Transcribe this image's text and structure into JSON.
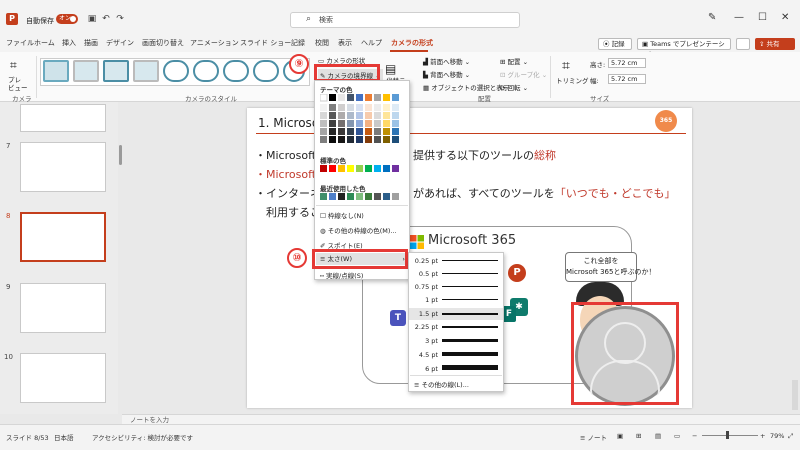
{
  "titlebar": {
    "app_logo": "P",
    "autosave_label": "自動保存",
    "autosave_toggle": "オン",
    "search_placeholder": "検索"
  },
  "tabs": [
    "ファイル",
    "ホーム",
    "挿入",
    "描画",
    "デザイン",
    "画面切り替え",
    "アニメーション",
    "スライド ショー",
    "記録",
    "校閲",
    "表示",
    "ヘルプ",
    "カメラの形式"
  ],
  "active_tab": "カメラの形式",
  "header_buttons": {
    "record": "記録",
    "teams": "Teams でプレゼンテーション",
    "share": "共有"
  },
  "ribbon": {
    "preview_label": "プレ\nビュー",
    "camera_group": "カメラ",
    "styles_group": "カメラのスタイル",
    "camera_shape": "カメラの形状",
    "camera_border": "カメラの境界線",
    "alt_text": "代替テ",
    "bring_forward": "前面へ移動",
    "send_backward": "背面へ移動",
    "selection_pane": "オブジェクトの選択と表示",
    "align": "配置",
    "group": "グループ化",
    "rotate": "回転",
    "arrange_group": "配置",
    "crop": "トリミング",
    "height_label": "高さ:",
    "height_value": "5.72 cm",
    "width_label": "幅:",
    "width_value": "5.72 cm",
    "size_group": "サイズ"
  },
  "callouts": {
    "step9": "⑨",
    "step10": "⑩"
  },
  "slides_panel": {
    "numbers": [
      "7",
      "8",
      "9",
      "10"
    ],
    "selected": "8"
  },
  "slide": {
    "title": "1. Microso",
    "bullet1_a": "・Microsoft 3",
    "bullet1_b": "提供する以下のツールの",
    "bullet1_c": "総称",
    "bullet2": "・Microsoft 3",
    "bullet3_a": "・インターネ",
    "bullet3_b": "があれば、すべてのツールを",
    "bullet3_c": "「いつでも・どこでも」",
    "bullet4": "利用するこ",
    "ms365": "Microsoft 365",
    "speech": "これ全部を\nMicrosoft 365と呼ぶのか！",
    "badge": "カレッジ\n365"
  },
  "menu": {
    "theme_colors": "テーマの色",
    "standard_colors": "標準の色",
    "recent_colors": "最近使用した色",
    "no_outline": "枠線なし(N)",
    "more_colors": "その他の枠線の色(M)...",
    "eyedropper": "スポイト(E)",
    "weight": "太さ(W)",
    "dashes": "実線/点線(S)"
  },
  "weights": {
    "items": [
      "0.25 pt",
      "0.5 pt",
      "0.75 pt",
      "1 pt",
      "1.5 pt",
      "2.25 pt",
      "3 pt",
      "4.5 pt",
      "6 pt"
    ],
    "selected": "1.5 pt",
    "more": "その他の線(L)..."
  },
  "notes": "ノートを入力",
  "status": {
    "slide": "スライド 8/53",
    "language": "日本語",
    "accessibility": "アクセシビリティ: 検討が必要です",
    "notes_btn": "ノート",
    "zoom": "79%"
  },
  "colors": {
    "accent": "#c43e1c",
    "highlight": "#e53935"
  }
}
